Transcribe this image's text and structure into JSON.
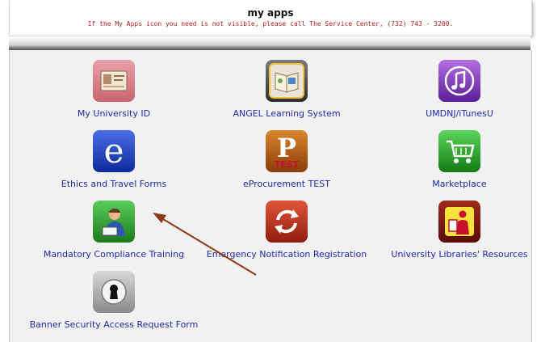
{
  "header": {
    "title": "my apps",
    "notice": "If the My Apps icon you need is not visible, please call The Service Center, (732) 743 - 3200."
  },
  "apps": [
    {
      "label": "My University ID",
      "icon": "id-card-icon"
    },
    {
      "label": "ANGEL Learning System",
      "icon": "book-icon"
    },
    {
      "label": "UMDNJ/iTunesU",
      "icon": "music-note-icon"
    },
    {
      "label": "Ethics and Travel Forms",
      "icon": "letter-e-icon"
    },
    {
      "label": "eProcurement TEST",
      "icon": "letter-p-test-icon"
    },
    {
      "label": "Marketplace",
      "icon": "shopping-cart-icon"
    },
    {
      "label": "Mandatory Compliance Training",
      "icon": "person-reading-icon"
    },
    {
      "label": "Emergency Notification Registration",
      "icon": "refresh-arrows-icon"
    },
    {
      "label": "University Libraries' Resources",
      "icon": "library-reader-icon"
    },
    {
      "label": "Banner Security Access Request Form",
      "icon": "keyhole-icon"
    }
  ],
  "icon_text": {
    "letter_e": "e",
    "letter_p": "P",
    "test": "TEST"
  },
  "colors": {
    "link": "#1e2aa8",
    "notice": "#b31b1b",
    "arrow": "#8b3a1a"
  }
}
